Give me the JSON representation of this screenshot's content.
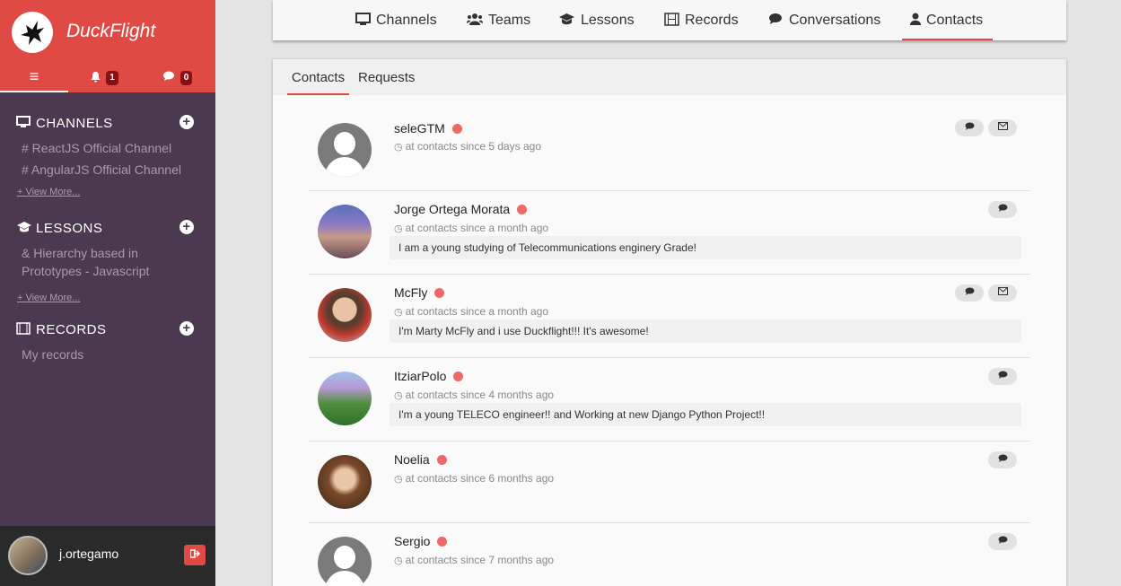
{
  "app": {
    "name": "DuckFlight"
  },
  "sidebar": {
    "tabs": [
      {
        "icon": "menu-icon",
        "glyph": "≡"
      },
      {
        "icon": "bell-icon",
        "glyph": "🔔",
        "badge": "1"
      },
      {
        "icon": "chat-icon",
        "glyph": "💬",
        "badge": "0"
      }
    ],
    "channels": {
      "title": "CHANNELS",
      "items": [
        "# ReactJS Official Channel",
        "# AngularJS Official Channel"
      ],
      "view_more": "+ View More..."
    },
    "lessons": {
      "title": "LESSONS",
      "items": [
        "& Hierarchy based in",
        "Prototypes - Javascript"
      ],
      "view_more": "+ View More..."
    },
    "records": {
      "title": "RECORDS",
      "items": [
        "My records"
      ]
    },
    "user": {
      "name": "j.ortegamo"
    }
  },
  "topnav": {
    "items": [
      "Channels",
      "Teams",
      "Lessons",
      "Records",
      "Conversations",
      "Contacts"
    ],
    "active": "Contacts"
  },
  "subtabs": {
    "items": [
      "Contacts",
      "Requests"
    ],
    "active": "Contacts"
  },
  "contacts": [
    {
      "name": "seleGTM",
      "since": "at contacts since 5 days ago",
      "bio": "",
      "online": true,
      "actions": [
        "chat",
        "mail"
      ]
    },
    {
      "name": "Jorge Ortega Morata",
      "since": "at contacts since a month ago",
      "bio": "I am a young studying of Telecommunications enginery Grade!",
      "online": true,
      "actions": [
        "chat"
      ]
    },
    {
      "name": "McFly",
      "since": "at contacts since a month ago",
      "bio": "I'm Marty McFly and i use Duckflight!!! It's awesome!",
      "online": true,
      "actions": [
        "chat",
        "mail"
      ]
    },
    {
      "name": "ItziarPolo",
      "since": "at contacts since 4 months ago",
      "bio": "I'm a young TELECO engineer!! and Working at new Django Python Project!!",
      "online": true,
      "actions": [
        "chat"
      ]
    },
    {
      "name": "Noelia",
      "since": "at contacts since 6 months ago",
      "bio": "",
      "online": true,
      "actions": [
        "chat"
      ]
    },
    {
      "name": "Sergio",
      "since": "at contacts since 7 months ago",
      "bio": "",
      "online": true,
      "actions": [
        "chat"
      ]
    }
  ],
  "colors": {
    "brand": "#e04a44",
    "sidebar": "#4b3a4f",
    "online": "#ef6868"
  }
}
